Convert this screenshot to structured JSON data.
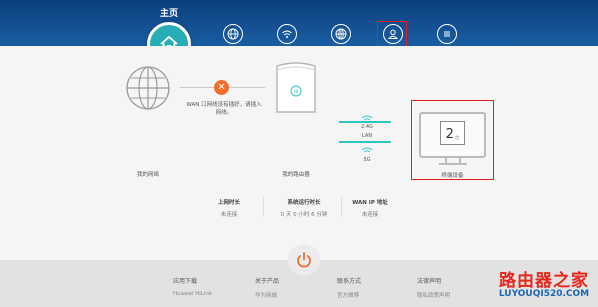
{
  "header": {
    "title": "主页",
    "nav_icons": [
      "home-icon",
      "globe-icon",
      "wifi-icon",
      "network-icon",
      "user-icon",
      "menu-icon"
    ]
  },
  "diagram": {
    "internet_label": "我的网络",
    "wan_error": "WAN 口网线没有插好，请插入网线。",
    "router_label": "我的路由器",
    "bands": [
      "2.4G",
      "LAN",
      "5G"
    ],
    "terminal_label": "终端设备",
    "terminal_count": "2",
    "terminal_unit": "台"
  },
  "stats": [
    {
      "label": "上网时长",
      "value": "未连接"
    },
    {
      "label": "系统运行时长",
      "value": "0 天 0 小时 6 分钟"
    },
    {
      "label": "WAN IP 地址",
      "value": "未连接"
    }
  ],
  "footer": {
    "columns": [
      {
        "title": "应用下载",
        "item": "Huawei HiLink"
      },
      {
        "title": "关于产品",
        "item": "华为商城"
      },
      {
        "title": "联系方式",
        "item": "官方微博"
      },
      {
        "title": "法律声明",
        "item": "隐私政策声明"
      }
    ]
  },
  "watermark": {
    "line1": "路由器之家",
    "line2": "LUYOUQI520.COM"
  },
  "colors": {
    "header": "#0b3f7c",
    "accent": "#27aeb4",
    "error": "#f26d2b",
    "highlight": "#e02020",
    "power": "#f26d2b"
  }
}
